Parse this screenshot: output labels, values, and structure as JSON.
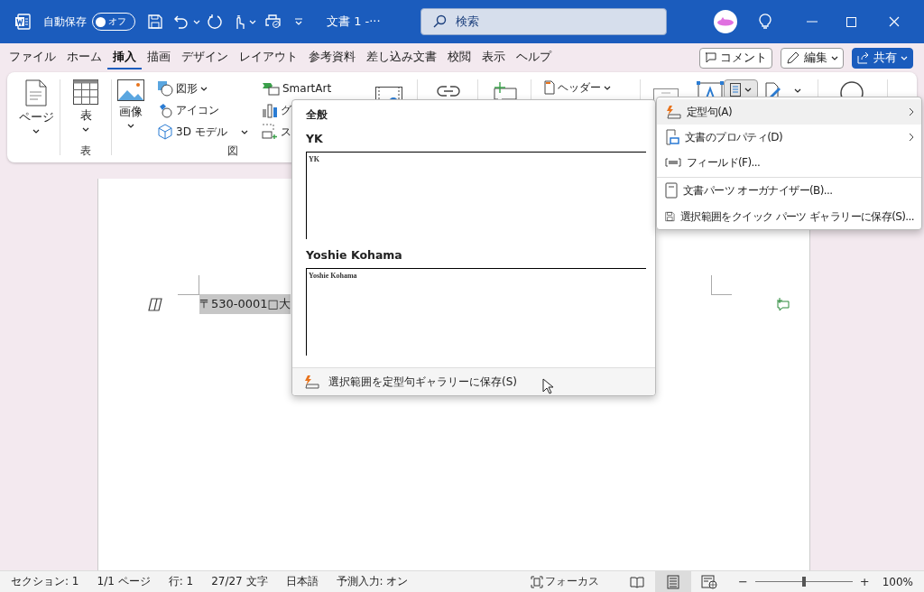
{
  "title_bar": {
    "autosave_label": "自動保存",
    "autosave": {
      "on": false,
      "label": "オフ"
    },
    "document_title": "文書 1 -···",
    "search": {
      "placeholder": "検索"
    }
  },
  "tabs": [
    {
      "label": "ファイル",
      "selected": false
    },
    {
      "label": "ホーム",
      "selected": false
    },
    {
      "label": "挿入",
      "selected": true
    },
    {
      "label": "描画",
      "selected": false
    },
    {
      "label": "デザイン",
      "selected": false
    },
    {
      "label": "レイアウト",
      "selected": false
    },
    {
      "label": "参考資料",
      "selected": false
    },
    {
      "label": "差し込み文書",
      "selected": false
    },
    {
      "label": "校閲",
      "selected": false
    },
    {
      "label": "表示",
      "selected": false
    },
    {
      "label": "ヘルプ",
      "selected": false
    }
  ],
  "tab_actions": {
    "comment": "コメント",
    "edit": "編集",
    "share": "共有"
  },
  "ribbon": {
    "page": "ページ",
    "table": {
      "button": "表",
      "group": "表"
    },
    "illustrations": {
      "picture": "画像",
      "shapes": "図形",
      "icons": "アイコン",
      "model": "3D モデル",
      "smartart": "SmartArt",
      "chart": "グ",
      "screenshot": "ス",
      "group": "図"
    },
    "header": "ヘッダー",
    "quick_parts": {
      "expanded": true
    }
  },
  "document": {
    "text": "〒530-0001□大"
  },
  "autotext_gallery": {
    "heading": "全般",
    "entries": [
      {
        "name": "YK",
        "preview": "YK"
      },
      {
        "name": "Yoshie Kohama",
        "preview": "Yoshie Kohama"
      }
    ],
    "footer": "選択範囲を定型句ギャラリーに保存(S)"
  },
  "quick_parts_menu": [
    {
      "kind": "autotext",
      "label": "定型句(A)",
      "submenu": true,
      "selected": true,
      "separator": false
    },
    {
      "kind": "property",
      "label": "文書のプロパティ(D)",
      "submenu": true,
      "selected": false,
      "separator": false
    },
    {
      "kind": "field",
      "label": "フィールド(F)...",
      "submenu": false,
      "selected": false,
      "separator": false
    },
    {
      "kind": "organizer",
      "label": "文書パーツ オーガナイザー(B)...",
      "submenu": false,
      "selected": false,
      "separator": true
    },
    {
      "kind": "save",
      "label": "選択範囲をクイック パーツ ギャラリーに保存(S)...",
      "submenu": false,
      "selected": false,
      "separator": false
    }
  ],
  "status_bar": {
    "items": [
      "セクション: 1",
      "1/1 ページ",
      "行: 1",
      "27/27 文字",
      "日本語",
      "予測入力: オン"
    ],
    "focus": "フォーカス",
    "views": [
      {
        "kind": "read",
        "selected": false
      },
      {
        "kind": "print",
        "selected": true
      },
      {
        "kind": "web",
        "selected": false
      }
    ],
    "zoom": {
      "minus": "−",
      "plus": "+",
      "level": 0.5,
      "label": "100%"
    }
  }
}
